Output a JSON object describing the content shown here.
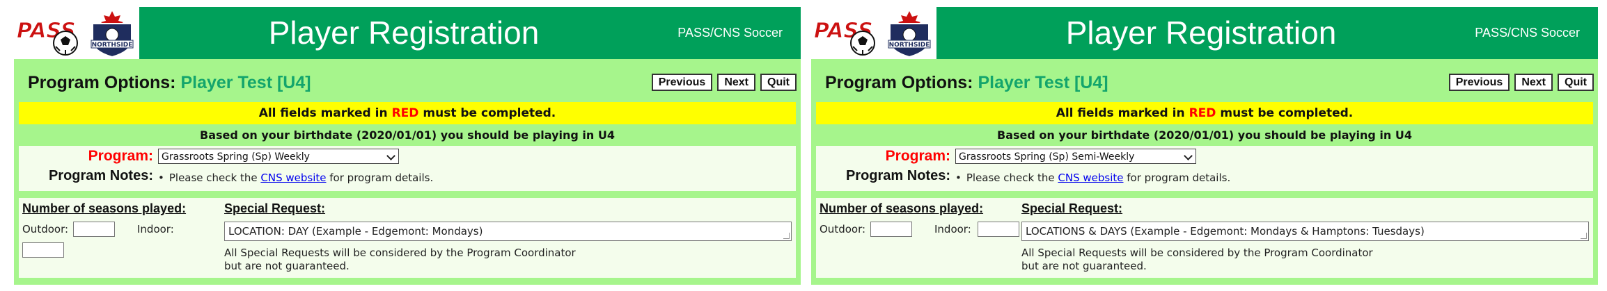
{
  "colors": {
    "banner_green": "#00a05a",
    "body_green": "#a6f58c",
    "player_green": "#13a56c",
    "notice_yellow": "#ffff00",
    "required_red": "#ff0000",
    "link_blue": "#0000ee"
  },
  "logos": {
    "pass": "PASS",
    "northside": "NORTHSIDE"
  },
  "banner": {
    "title": "Player Registration",
    "subtitle": "PASS/CNS Soccer"
  },
  "options": {
    "heading": "Program Options:",
    "player": "Player Test [U4]"
  },
  "nav": {
    "previous": "Previous",
    "next": "Next",
    "quit": "Quit"
  },
  "notice": {
    "prefix": "All fields marked in",
    "red": "RED",
    "suffix": "must be completed."
  },
  "birthdate_line": "Based on your birthdate (2020/01/01) you should be playing in U4",
  "program": {
    "label": "Program:",
    "notes_label": "Program Notes:",
    "notes_prefix": "Please check the",
    "notes_link": "CNS website",
    "notes_suffix": "for program details."
  },
  "seasons": {
    "title": "Number of seasons played:",
    "outdoor_label": "Outdoor:",
    "indoor_label": "Indoor:"
  },
  "special": {
    "title": "Special Request:",
    "note_line1": "All Special Requests will be considered by the Program Coordinator",
    "note_line2": "but are not guaranteed."
  },
  "panels": [
    {
      "program_selected": "Grassroots Spring (Sp) Weekly",
      "special_placeholder": "LOCATION: DAY (Example - Edgemont: Mondays)"
    },
    {
      "program_selected": "Grassroots Spring (Sp) Semi-Weekly",
      "special_placeholder": "LOCATIONS & DAYS (Example - Edgemont: Mondays & Hamptons: Tuesdays)"
    }
  ]
}
